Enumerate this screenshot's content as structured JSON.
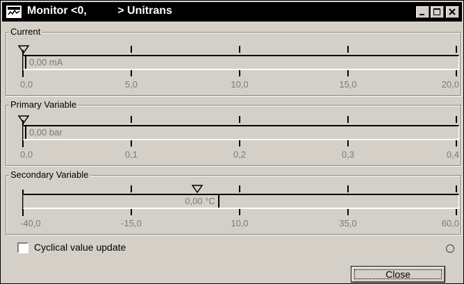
{
  "window": {
    "title": "Monitor <0,          > Unitrans",
    "icon": "monitor-app-icon",
    "controls": [
      "minimize-icon",
      "maximize-icon",
      "close-icon"
    ]
  },
  "groups": [
    {
      "label": "Current",
      "value_text": "0,00 mA",
      "value": 0.0,
      "range": [
        0.0,
        20.0
      ],
      "ticks": [
        "0,0",
        "5,0",
        "10,0",
        "15,0",
        "20,0"
      ]
    },
    {
      "label": "Primary Variable",
      "value_text": "0,00 bar",
      "value": 0.0,
      "range": [
        0.0,
        0.4
      ],
      "ticks": [
        "0,0",
        "0,1",
        "0,2",
        "0,3",
        "0,4"
      ]
    },
    {
      "label": "Secondary Variable",
      "value_text": "0,00 °C",
      "value": 0.0,
      "range": [
        -40.0,
        60.0
      ],
      "ticks": [
        "-40,0",
        "-15,0",
        "10,0",
        "35,0",
        "60,0"
      ]
    }
  ],
  "checkbox": {
    "label": "Cyclical value update",
    "checked": false
  },
  "close_button": {
    "label": "Close"
  },
  "colors": {
    "titlebar": "#000000",
    "face": "#d4d0c8",
    "value_text": "#7a7a7a"
  }
}
